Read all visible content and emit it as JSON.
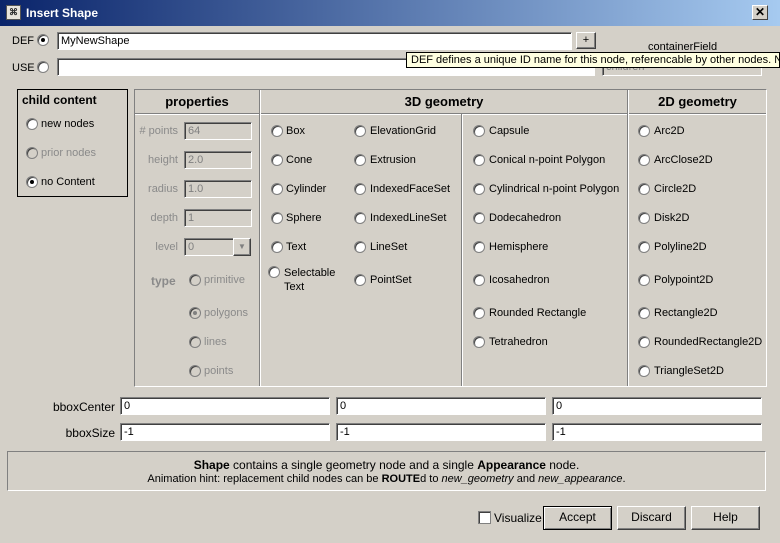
{
  "window": {
    "title": "Insert Shape",
    "close": "✕"
  },
  "def": {
    "label": "DEF",
    "value": "MyNewShape",
    "plus": "+"
  },
  "use": {
    "label": "USE",
    "value": ""
  },
  "containerField": {
    "label": "containerField",
    "value": "children"
  },
  "tooltip": "DEF defines a unique ID name for this node, referencable by other nodes.  No",
  "childContent": {
    "title": "child content",
    "options": [
      "new nodes",
      "prior nodes",
      "no Content"
    ],
    "selected": "no Content"
  },
  "properties": {
    "title": "properties",
    "points": {
      "label": "# points",
      "value": "64"
    },
    "height": {
      "label": "height",
      "value": "2.0"
    },
    "radius": {
      "label": "radius",
      "value": "1.0"
    },
    "depth": {
      "label": "depth",
      "value": "1"
    },
    "level": {
      "label": "level",
      "value": "0"
    },
    "type": {
      "label": "type",
      "options": [
        "primitive",
        "polygons",
        "lines",
        "points"
      ],
      "selected": "polygons"
    }
  },
  "geometry3d": {
    "title": "3D geometry",
    "col1": [
      "Box",
      "Cone",
      "Cylinder",
      "Sphere",
      "Text",
      "Selectable Text"
    ],
    "col2": [
      "ElevationGrid",
      "Extrusion",
      "IndexedFaceSet",
      "IndexedLineSet",
      "LineSet",
      "PointSet"
    ],
    "col3": [
      "Capsule",
      "Conical n-point Polygon",
      "Cylindrical n-point Polygon",
      "Dodecahedron",
      "Hemisphere",
      "Icosahedron",
      "Rounded Rectangle",
      "Tetrahedron"
    ]
  },
  "geometry2d": {
    "title": "2D geometry",
    "items": [
      "Arc2D",
      "ArcClose2D",
      "Circle2D",
      "Disk2D",
      "Polyline2D",
      "Polypoint2D",
      "Rectangle2D",
      "RoundedRectangle2D",
      "TriangleSet2D"
    ]
  },
  "bbox": {
    "centerLabel": "bboxCenter",
    "center": [
      "0",
      "0",
      "0"
    ],
    "sizeLabel": "bboxSize",
    "size": [
      "-1",
      "-1",
      "-1"
    ]
  },
  "info": {
    "line1_b1": "Shape",
    "line1_t1": " contains a single geometry node and a single ",
    "line1_b2": "Appearance",
    "line1_t2": " node.",
    "line2_t1": "Animation hint: replacement child nodes can be ",
    "line2_b1": "ROUTE",
    "line2_t2": "d to ",
    "line2_i1": "new_geometry",
    "line2_t3": " and ",
    "line2_i2": "new_appearance",
    "line2_t4": "."
  },
  "buttons": {
    "visualize": "Visualize",
    "accept": "Accept",
    "discard": "Discard",
    "help": "Help"
  }
}
